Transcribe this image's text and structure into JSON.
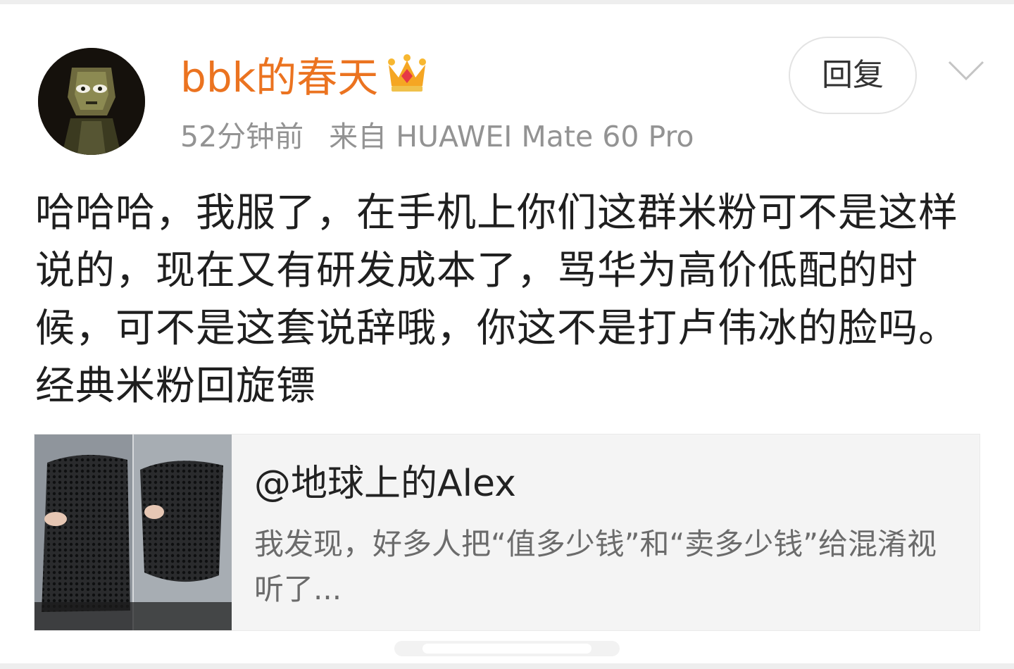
{
  "post": {
    "username": "bbk的春天",
    "time": "52分钟前",
    "source": "来自 HUAWEI Mate 60 Pro",
    "reply_label": "回复",
    "text": "哈哈哈，我服了，在手机上你们这群米粉可不是这样说的，现在又有研发成本了，骂华为高价低配的时候，可不是这套说辞哦，你这不是打卢伟冰的脸吗。经典米粉回旋镖"
  },
  "quote": {
    "author": "@地球上的Alex",
    "excerpt": "我发现，好多人把“值多少钱”和“卖多少钱”给混淆视听了..."
  },
  "icons": {
    "badge": "crown-icon",
    "menu": "chevron-down-icon"
  },
  "colors": {
    "username": "#eb7320",
    "meta": "#939393",
    "body_text": "#1f1f1f",
    "card_bg": "#f4f4f4"
  }
}
